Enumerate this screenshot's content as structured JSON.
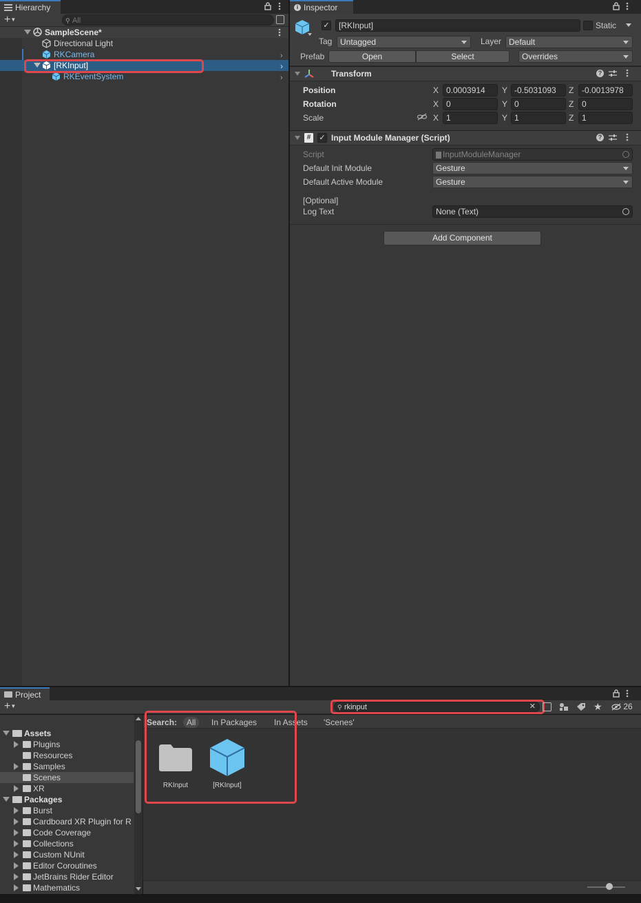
{
  "hierarchy": {
    "tab_label": "Hierarchy",
    "search_placeholder": "All",
    "scene_name": "SampleScene*",
    "items": [
      {
        "label": "Directional Light"
      },
      {
        "label": "RKCamera"
      },
      {
        "label": "[RKInput]"
      },
      {
        "label": "RKEventSystem"
      }
    ]
  },
  "inspector": {
    "tab_label": "Inspector",
    "object_name": "[RKInput]",
    "static_label": "Static",
    "tag_label": "Tag",
    "tag_value": "Untagged",
    "layer_label": "Layer",
    "layer_value": "Default",
    "prefab_label": "Prefab",
    "prefab_open": "Open",
    "prefab_select": "Select",
    "prefab_overrides": "Overrides",
    "transform": {
      "title": "Transform",
      "position_label": "Position",
      "rotation_label": "Rotation",
      "scale_label": "Scale",
      "position": {
        "x": "0.0003914",
        "y": "-0.5031093",
        "z": "-0.0013978"
      },
      "rotation": {
        "x": "0",
        "y": "0",
        "z": "0"
      },
      "scale": {
        "x": "1",
        "y": "1",
        "z": "1"
      },
      "axis_x": "X",
      "axis_y": "Y",
      "axis_z": "Z"
    },
    "script_component": {
      "title": "Input Module Manager (Script)",
      "script_label": "Script",
      "script_value": "InputModuleManager",
      "default_init_label": "Default Init Module",
      "default_init_value": "Gesture",
      "default_active_label": "Default Active Module",
      "default_active_value": "Gesture",
      "optional_label": "[Optional]",
      "log_text_label": "Log Text",
      "log_text_value": "None (Text)"
    },
    "add_component": "Add Component"
  },
  "project": {
    "tab_label": "Project",
    "search_value": "rkinput",
    "hidden_count": "26",
    "search_label": "Search:",
    "search_tabs": [
      "All",
      "In Packages",
      "In Assets",
      "'Scenes'"
    ],
    "tree": {
      "assets_label": "Assets",
      "assets_children": [
        "Plugins",
        "Resources",
        "Samples",
        "Scenes",
        "XR"
      ],
      "packages_label": "Packages",
      "packages_children": [
        "Burst",
        "Cardboard XR Plugin for R",
        "Code Coverage",
        "Collections",
        "Custom NUnit",
        "Editor Coroutines",
        "JetBrains Rider Editor",
        "Mathematics"
      ]
    },
    "results": [
      {
        "label": "RKInput",
        "icon": "folder-icon"
      },
      {
        "label": "[RKInput]",
        "icon": "prefab-cube-icon"
      }
    ]
  },
  "colors": {
    "highlight": "#e0474c",
    "selection": "#2c5d87",
    "prefab_blue": "#7cb9ea"
  }
}
